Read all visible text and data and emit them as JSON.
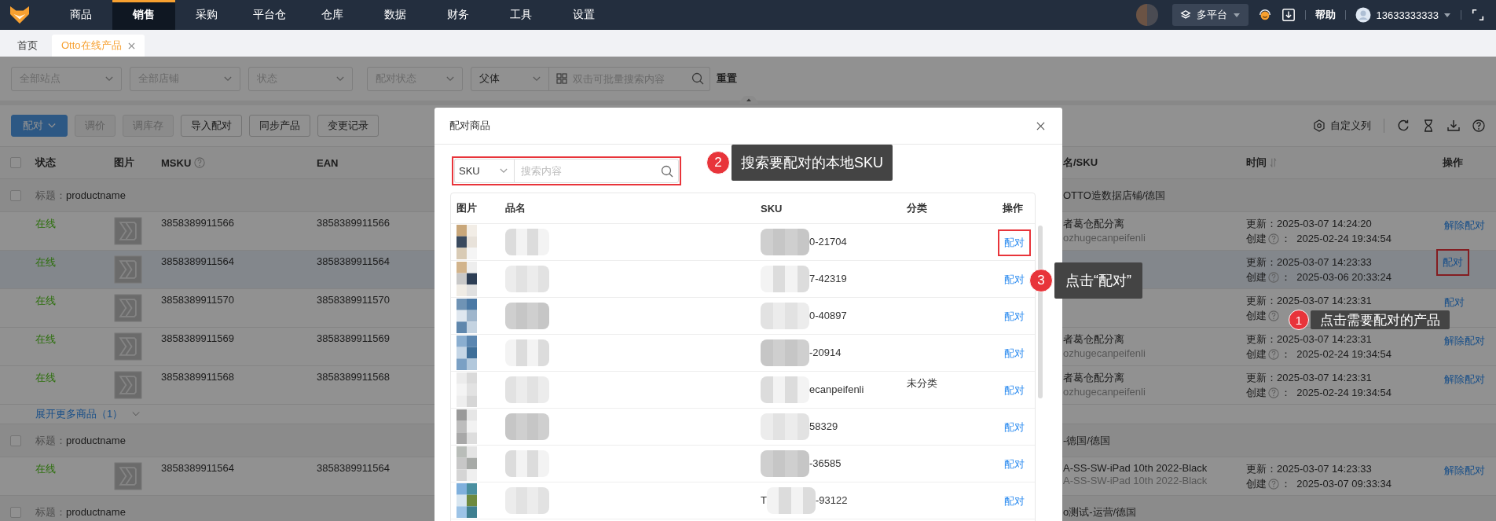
{
  "nav": {
    "items": [
      {
        "label": "商品",
        "selected": false
      },
      {
        "label": "销售",
        "selected": true
      },
      {
        "label": "采购",
        "selected": false
      },
      {
        "label": "平台仓",
        "selected": false
      },
      {
        "label": "仓库",
        "selected": false
      },
      {
        "label": "数据",
        "selected": false
      },
      {
        "label": "财务",
        "selected": false
      },
      {
        "label": "工具",
        "selected": false
      },
      {
        "label": "设置",
        "selected": false
      }
    ],
    "platform": "多平台",
    "help": "帮助",
    "user": "13633333333"
  },
  "tabs": [
    {
      "label": "首页",
      "selected": false,
      "closable": false
    },
    {
      "label": "Otto在线产品",
      "selected": true,
      "closable": true
    }
  ],
  "filters": [
    {
      "kind": "select",
      "placeholder": "全部站点"
    },
    {
      "kind": "select",
      "placeholder": "全部店铺"
    },
    {
      "kind": "select",
      "placeholder": "状态"
    },
    {
      "kind": "select",
      "placeholder": "配对状态"
    }
  ],
  "search": {
    "mode": "父体",
    "placeholder": "双击可批量搜索内容",
    "reset": "重置"
  },
  "toolbar": {
    "buttons": [
      {
        "label": "配对",
        "kind": "dropdown",
        "disabled": true
      },
      {
        "label": "调价",
        "kind": "plain",
        "disabled": true
      },
      {
        "label": "调库存",
        "kind": "plain",
        "disabled": true
      },
      {
        "label": "导入配对",
        "kind": "plain",
        "disabled": false
      },
      {
        "label": "同步产品",
        "kind": "plain",
        "disabled": false
      },
      {
        "label": "变更记录",
        "kind": "plain",
        "disabled": false
      }
    ],
    "custom_columns": "自定义列"
  },
  "table": {
    "select_all_checked": false,
    "columns": [
      {
        "label": "状态"
      },
      {
        "label": "图片"
      },
      {
        "label": "MSKU",
        "help": true
      },
      {
        "label": "EAN"
      },
      {
        "label": "名/SKU"
      },
      {
        "label": "时间",
        "sortable": true
      },
      {
        "label": "操作"
      }
    ],
    "rows": [
      {
        "kind": "group",
        "checked": false,
        "title_label": "标题：",
        "title": "productname",
        "shop": "OTTO造数据店铺/德国"
      },
      {
        "kind": "product",
        "selected": false,
        "status": "在线",
        "msku": "3858389911566",
        "ean": "3858389911566",
        "name": "者葛仓配分离",
        "sku": "ozhugecanpeifenli",
        "updated_label": "更新：",
        "updated": "2025-03-07 14:24:20",
        "created_label": "创建",
        "created": "：  2025-02-24 19:34:54",
        "action": "解除配对",
        "highlighted": false
      },
      {
        "kind": "product",
        "selected": true,
        "status": "在线",
        "msku": "3858389911564",
        "ean": "3858389911564",
        "updated_label": "更新：",
        "updated": "2025-03-07 14:23:33",
        "created_label": "创建",
        "created": "：  2025-03-06 20:33:24",
        "action": "配对",
        "highlighted": true
      },
      {
        "kind": "product",
        "selected": false,
        "status": "在线",
        "msku": "3858389911570",
        "ean": "3858389911570",
        "updated_label": "更新：",
        "updated": "2025-03-07 14:23:31",
        "created_label": "创建",
        "action": "配对",
        "highlighted": false
      },
      {
        "kind": "product",
        "selected": false,
        "status": "在线",
        "msku": "3858389911569",
        "ean": "3858389911569",
        "name": "者葛仓配分离",
        "sku": "ozhugecanpeifenli",
        "updated_label": "更新：",
        "updated": "2025-03-07 14:23:31",
        "created_label": "创建",
        "created": "：  2025-02-24 19:34:54",
        "action": "解除配对",
        "highlighted": false
      },
      {
        "kind": "product",
        "selected": false,
        "status": "在线",
        "msku": "3858389911568",
        "ean": "3858389911568",
        "name": "者葛仓配分离",
        "sku": "ozhugecanpeifenli",
        "updated_label": "更新：",
        "updated": "2025-03-07 14:23:31",
        "created_label": "创建",
        "created": "：  2025-02-24 19:34:54",
        "action": "解除配对",
        "highlighted": false
      },
      {
        "kind": "expand",
        "label": "展开更多商品（1）"
      },
      {
        "kind": "group",
        "checked": false,
        "title_label": "标题：",
        "title": "productname",
        "shop": "-德国/德国"
      },
      {
        "kind": "product",
        "selected": false,
        "status": "在线",
        "msku": "3858389911564",
        "ean": "3858389911564",
        "name": "A-SS-SW-iPad 10th 2022-Black",
        "sku": "A-SS-SW-iPad 10th 2022-Black",
        "updated_label": "更新：",
        "updated": "2025-03-07 14:23:33",
        "created_label": "创建",
        "created": "：  2025-03-07 09:33:34",
        "action": "解除配对",
        "highlighted": false
      },
      {
        "kind": "group",
        "checked": false,
        "title_label": "标题：",
        "title": "productname",
        "shop": "o测试-运营/德国"
      }
    ]
  },
  "modal": {
    "title": "配对商品",
    "search": {
      "field": "SKU",
      "placeholder": "搜索内容",
      "highlighted": true
    },
    "columns": [
      "图片",
      "品名",
      "SKU",
      "分类",
      "操作"
    ],
    "rows": [
      {
        "sku": "0-21704",
        "action": "配对",
        "highlighted": true
      },
      {
        "sku": "7-42319",
        "action": "配对",
        "highlighted": false
      },
      {
        "sku": "0-40897",
        "action": "配对",
        "highlighted": false
      },
      {
        "sku": "-20914",
        "action": "配对",
        "highlighted": false
      },
      {
        "sku": "ecanpeifenli",
        "category": "未分类",
        "action": "配对",
        "highlighted": false
      },
      {
        "sku": "58329",
        "action": "配对",
        "highlighted": false
      },
      {
        "sku": "-36585",
        "action": "配对",
        "highlighted": false
      },
      {
        "sku_prefix": "T",
        "sku": "-93122",
        "action": "配对",
        "highlighted": false
      }
    ]
  },
  "annotations": [
    {
      "number": "2",
      "text": "搜索要配对的本地SKU"
    },
    {
      "number": "3",
      "text": "点击“配对”"
    },
    {
      "number": "1",
      "text": "点击需要配对的产品"
    }
  ]
}
